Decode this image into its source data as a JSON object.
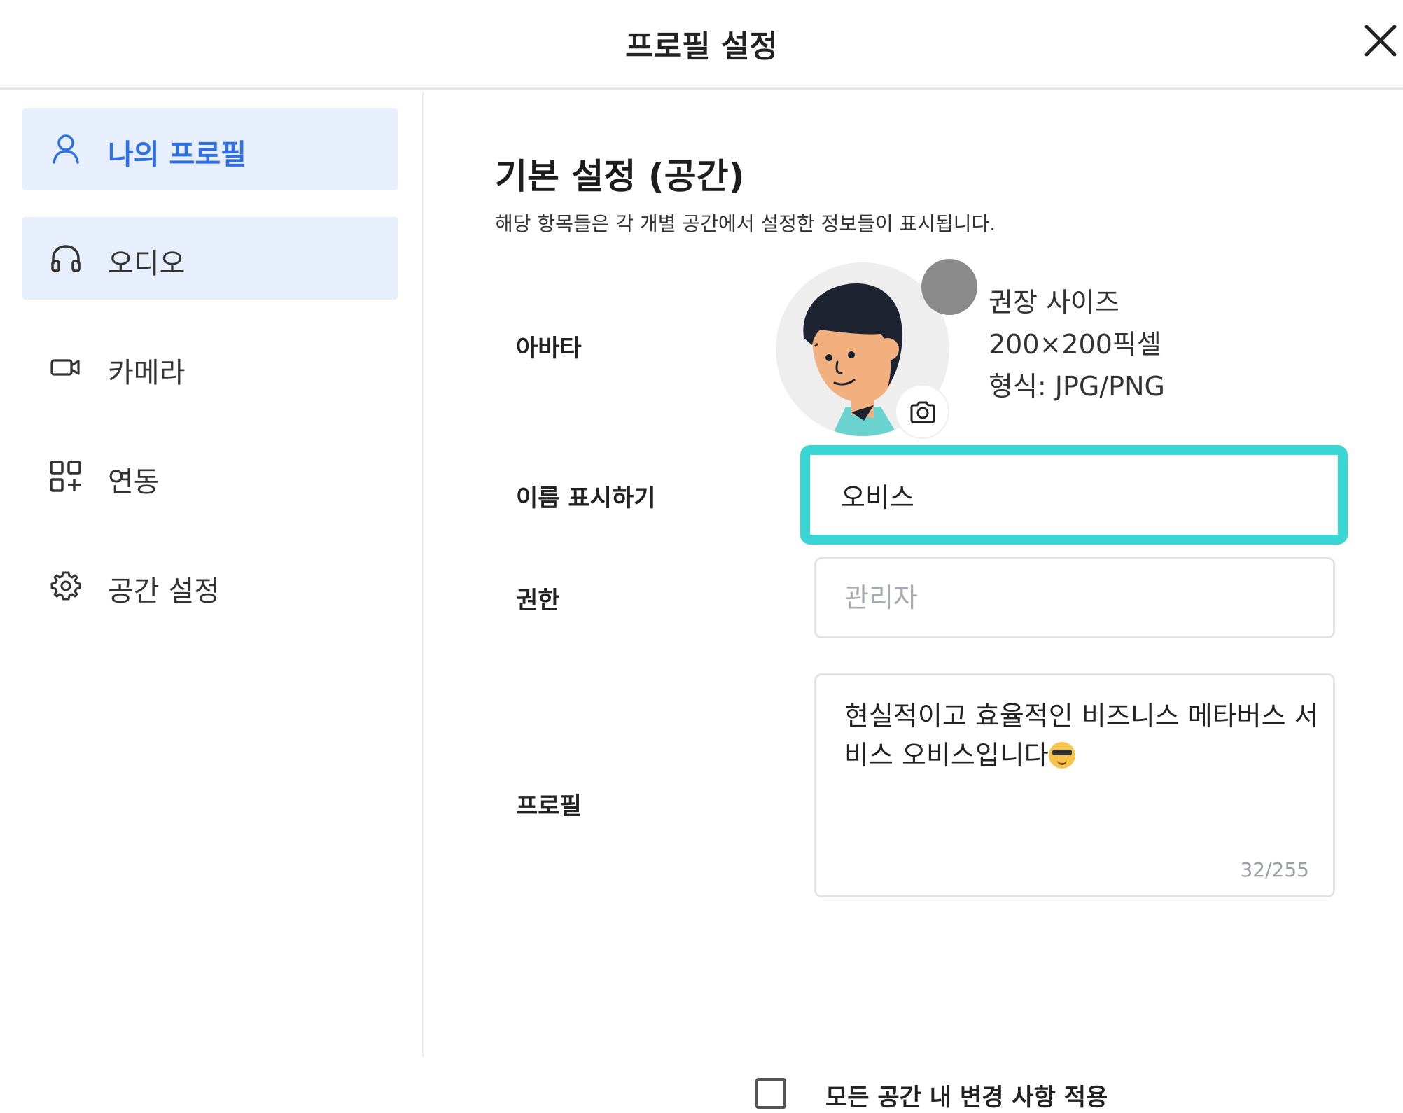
{
  "header": {
    "title": "프로필 설정"
  },
  "sidebar": {
    "items": [
      {
        "label": "나의 프로필",
        "icon": "user-icon",
        "state": "active"
      },
      {
        "label": "오디오",
        "icon": "headphones-icon",
        "state": "hover"
      },
      {
        "label": "카메라",
        "icon": "camera-icon",
        "state": "normal"
      },
      {
        "label": "연동",
        "icon": "apps-add-icon",
        "state": "normal"
      },
      {
        "label": "공간 설정",
        "icon": "gear-icon",
        "state": "normal"
      }
    ]
  },
  "main": {
    "section_title": "기본 설정 (공간)",
    "section_desc": "해당 항목들은 각 개별 공간에서 설정한 정보들이 표시됩니다.",
    "avatar": {
      "label": "아바타",
      "recommended_size_title": "권장 사이즈",
      "recommended_size_value": "200×200픽셀",
      "format": "형식: JPG/PNG"
    },
    "display_name": {
      "label": "이름 표시하기",
      "value": "오비스"
    },
    "role": {
      "label": "권한",
      "value": "관리자"
    },
    "profile": {
      "label": "프로필",
      "text": "현실적이고 효율적인 비즈니스 메타버스 서비스 오비스입니다",
      "emoji": "😎",
      "counter": "32/255"
    },
    "apply_all": {
      "label": "모든 공간 내 변경 사항 적용",
      "checked": false
    }
  },
  "colors": {
    "accent_blue": "#2f6fe4",
    "nav_highlight": "#e8effc",
    "focus_cyan": "#3ad6d3",
    "border": "#e2e4e8"
  }
}
